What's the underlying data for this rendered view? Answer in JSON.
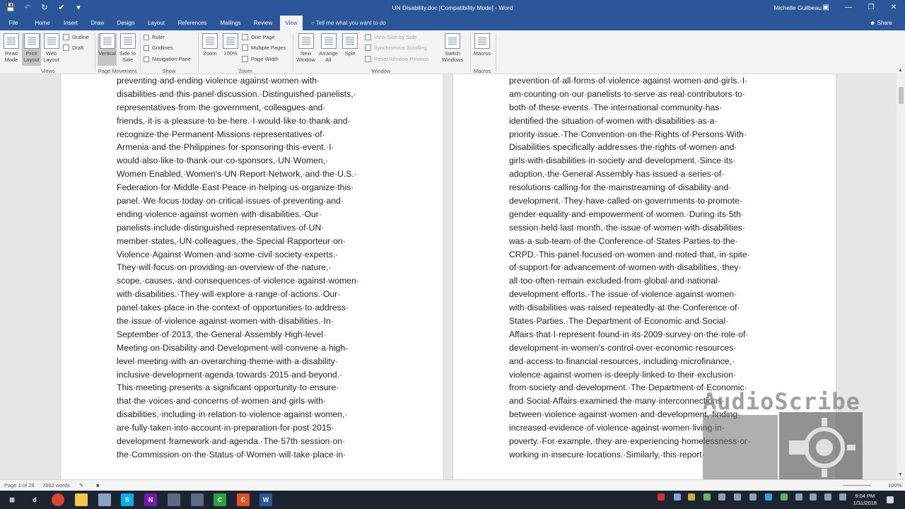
{
  "titlebar": {
    "document_title": "UN Disability.doc [Compatibility Mode] - Word",
    "user": "Michelle Guilbeau",
    "icons": [
      "save-icon",
      "undo-icon",
      "redo-icon",
      "touch-mode-icon",
      "customize-qat-icon"
    ],
    "window_controls": [
      "ribbon-display-icon",
      "minimize-icon",
      "restore-icon",
      "close-icon"
    ]
  },
  "tabs": [
    "File",
    "Home",
    "Insert",
    "Draw",
    "Design",
    "Layout",
    "References",
    "Mailings",
    "Review",
    "View"
  ],
  "active_tab": "View",
  "tell_me": "Tell me what you want to do",
  "share": "Share",
  "ribbon": {
    "views": {
      "read_mode": "Read Mode",
      "print_layout": "Print Layout",
      "web_layout": "Web Layout",
      "outline": "Outline",
      "draft": "Draft",
      "label": "Views"
    },
    "page_movement": {
      "vertical": "Vertical",
      "side_to_side": "Side to Side",
      "label": "Page Movement"
    },
    "show": {
      "ruler": "Ruler",
      "gridlines": "Gridlines",
      "navigation_pane": "Navigation Pane",
      "label": "Show"
    },
    "zoom": {
      "zoom": "Zoom",
      "hundred": "100%",
      "one_page": "One Page",
      "multiple_pages": "Multiple Pages",
      "page_width": "Page Width",
      "label": "Zoom"
    },
    "window": {
      "new_window": "New Window",
      "arrange_all": "Arrange All",
      "split": "Split",
      "view_side_by_side": "View Side by Side",
      "synchronous_scrolling": "Synchronous Scrolling",
      "reset_window_position": "Reset Window Position",
      "switch_windows": "Switch Windows",
      "label": "Window"
    },
    "macros": {
      "macros": "Macros",
      "label": "Macros"
    }
  },
  "left_page_lines": [
    "preventing·and·ending·violence·against·women·with·",
    "disabilities·and·this·panel·discussion.·Distinguished·panelists,·",
    "representatives·from·the·government,·colleagues·and·",
    "friends,·it·is·a·pleasure·to·be·here.·I·would·like·to·thank·and·",
    "recognize·the·Permanent·Missions·representatives·of·",
    "Armenia·and·the·Philippines·for·sponsoring·this·event.·I·",
    "would·also·like·to·thank·our·co-sponsors,·UN·Women,·",
    "Women·Enabled,·Women's·UN·Report·Network,·and·the·U.S.·",
    "Federation·for·Middle·East·Peace·in·helping·us·organize·this·",
    "panel.·We·focus·today·on·critical·issues·of·preventing·and·",
    "ending·violence·against·women·with·disabilities.·Our·",
    "panelists·include·distinguished·representatives·of·UN·",
    "member·states,·UN·colleagues,·the·Special·Rapporteur·on·",
    "Violence·Against·Women·and·some·civil·society·experts.·",
    "They·will·focus·on·providing·an·overview·of·the·nature,·",
    "scope,·causes,·and·consequences·of·violence·against·women·",
    "with·disabilities.·They·will·explore·a·range·of·actions.·Our·",
    "panel·takes·place·in·the·context·of·opportunities·to·address·",
    "the·issue·of·violence·against·women·with·disabilities.·In·",
    "September·of·2013,·the·General·Assembly·High-level·",
    "Meeting·on·Disability·and·Development·will·convene·a·high-",
    "level·meeting·with·an·overarching·theme·with·a·disability·",
    "inclusive·development·agenda·towards·2015·and·beyond.·",
    "This·meeting·presents·a·significant·opportunity·to·ensure·",
    "that·the·voices·and·concerns·of·women·and·girls·with·",
    "disabilities,·including·in·relation·to·violence·against·women,·",
    "are·fully·taken·into·account·in·preparation·for·post·2015·",
    "development·framework·and·agenda.·The·57th·session·on·",
    "the·Commission·on·the·Status·of·Women·will·take·place·in·"
  ],
  "right_page_lines": [
    "prevention·of·all·forms·of·violence·against·women·and·girls.·I·",
    "am·counting·on·our·panelists·to·serve·as·real·contributors·to·",
    "both·of·these·events.·The·international·community·has·",
    "identified·the·situation·of·women·with·disabilities·as·a·",
    "priority·issue.·The·Convention·on·the·Rights·of·Persons·With·",
    "Disabilities·specifically·addresses·the·rights·of·women·and·",
    "girls·with·disabilities·in·society·and·development.·Since·its·",
    "adoption,·the·General·Assembly·has·issued·a·series·of·",
    "resolutions·calling·for·the·mainstreaming·of·disability·and·",
    "development.·They·have·called·on·governments·to·promote·",
    "gender·equality·and·empowerment·of·women.·During·its·5th·",
    "session·held·last·month,·the·issue·of·women·with·disabilities·",
    "was·a·sub-team·of·the·Conference·of·States·Parties·to·the·",
    "CRPD.·This·panel·focused·on·women·and·noted·that,·in·spite·",
    "of·support·for·advancement·of·women·with·disabilities,·they·",
    "all·too·often·remain·excluded·from·global·and·national·",
    "development·efforts.·The·issue·of·violence·against·women·",
    "with·disabilities·was·raised·repeatedly·at·the·Conference·of·",
    "States·Parties.·The·Department·of·Economic·and·Social·",
    "Affairs·that·I·represent·found·in·its·2009·survey·on·the·role·of·",
    "development·in·women's·control·over·economic·resources·",
    "and·access·to·financial·resources,·including·microfinance,·",
    "violence·against·women·is·deeply·linked·to·their·exclusion·",
    "from·society·and·development.·The·Department·of·Economic·",
    "and·Social·Affairs·examined·the·many·interconnections·",
    "between·violence·against·women·and·development,·finding·",
    "increased·evidence·of·violence·against·women·living·in·",
    "poverty.·For·example,·they·are·experiencing·homelessness·or·",
    "working·in·insecure·locations.·Similarly,·this·report·"
  ],
  "watermark": "AudioScribe",
  "status": {
    "page": "Page 1 of 28",
    "words": "7662 words",
    "zoom": "100%"
  },
  "taskbar": {
    "icons": [
      "windows-start-icon",
      "search-icon",
      "chrome-icon",
      "file-explorer-icon",
      "app-icon",
      "skype-icon",
      "onenote-icon",
      "app-icon-2",
      "app-icon-3",
      "camtasia-icon",
      "camtasia-recorder-icon",
      "word-icon"
    ],
    "time": "9:04 PM",
    "date": "1/31/2018"
  }
}
